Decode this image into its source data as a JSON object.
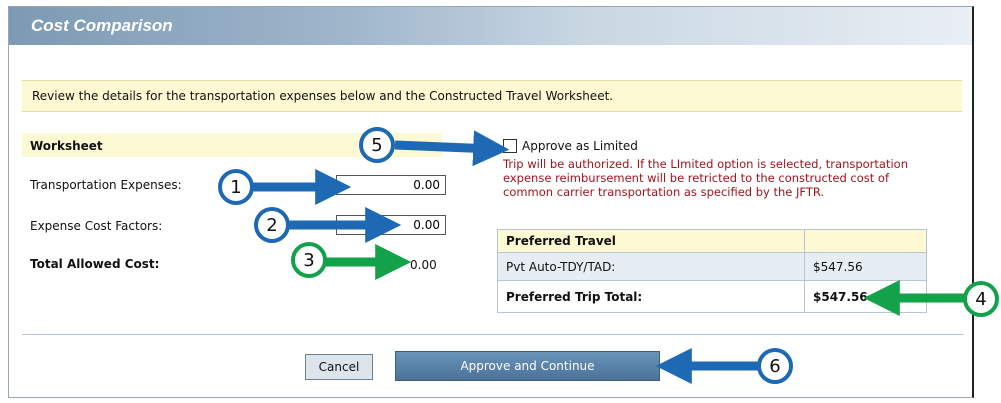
{
  "title": "Cost Comparison",
  "notice": "Review the details for the transportation expenses below and the Constructed Travel Worksheet.",
  "worksheet": {
    "heading": "Worksheet",
    "transport_label": "Transportation Expenses:",
    "transport_value": "0.00",
    "factors_label": "Expense Cost Factors:",
    "factors_value": "0.00",
    "total_label": "Total Allowed Cost:",
    "total_value": "0.00"
  },
  "limited": {
    "checkbox_label": "Approve as Limited",
    "checked": false,
    "warning": "Trip will be authorized. If the LImited option is selected, transportation expense reimbursement will be retricted to the constructed cost of common carrier transportation as specified by the JFTR."
  },
  "preferred": {
    "header": "Preferred Travel",
    "rows": [
      {
        "label": "Pvt Auto-TDY/TAD:",
        "value": "$547.56"
      },
      {
        "label": "Preferred Trip Total:",
        "value": "$547.56"
      }
    ]
  },
  "buttons": {
    "cancel": "Cancel",
    "approve": "Approve and Continue"
  },
  "callouts": [
    "1",
    "2",
    "3",
    "4",
    "5",
    "6"
  ],
  "colors": {
    "callout_blue": "#1d69b4",
    "callout_green": "#13a14a",
    "warning_red": "#a2151d",
    "highlight_yellow": "#fdf9d3"
  }
}
